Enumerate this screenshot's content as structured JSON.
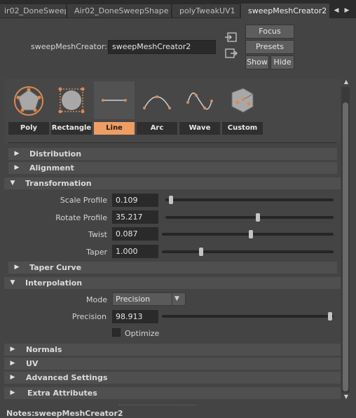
{
  "tabs": [
    {
      "label": "ir02_DoneSweep",
      "active": false
    },
    {
      "label": "Air02_DoneSweepShape",
      "active": false
    },
    {
      "label": "polyTweakUV1",
      "active": false
    },
    {
      "label": "sweepMeshCreator2",
      "active": true
    }
  ],
  "header": {
    "node_label": "sweepMeshCreator:",
    "node_name": "sweepMeshCreator2",
    "focus_label": "Focus",
    "presets_label": "Presets",
    "show_label": "Show",
    "hide_label": "Hide"
  },
  "shapes": [
    {
      "label": "Poly",
      "icon": "pentagon-icon",
      "selected": false
    },
    {
      "label": "Rectangle",
      "icon": "rectangle-icon",
      "selected": false
    },
    {
      "label": "Line",
      "icon": "line-icon",
      "selected": true
    },
    {
      "label": "Arc",
      "icon": "arc-icon",
      "selected": false
    },
    {
      "label": "Wave",
      "icon": "wave-icon",
      "selected": false
    },
    {
      "label": "Custom",
      "icon": "custom-shape-icon",
      "selected": false
    }
  ],
  "sections": {
    "distribution": "Distribution",
    "alignment": "Alignment",
    "transformation": "Transformation",
    "taper_curve": "Taper Curve",
    "interpolation": "Interpolation",
    "normals": "Normals",
    "uv": "UV",
    "advanced": "Advanced Settings",
    "extra": "Extra Attributes"
  },
  "transformation": {
    "scale_profile": {
      "label": "Scale Profile",
      "value": "0.109",
      "slider": 0.02
    },
    "rotate_profile": {
      "label": "Rotate Profile",
      "value": "35.217",
      "slider": 0.55
    },
    "twist": {
      "label": "Twist",
      "value": "0.087",
      "slider": 0.52
    },
    "taper": {
      "label": "Taper",
      "value": "1.000",
      "slider": 0.22
    }
  },
  "interpolation": {
    "mode_label": "Mode",
    "mode_value": "Precision",
    "precision_label": "Precision",
    "precision_value": "98.913",
    "precision_slider": 0.99,
    "optimize_label": "Optimize",
    "optimize_checked": false
  },
  "notes": {
    "label": "Notes:",
    "value": "sweepMeshCreator2"
  },
  "colors": {
    "accent": "#ee9d63",
    "background": "#444444"
  }
}
